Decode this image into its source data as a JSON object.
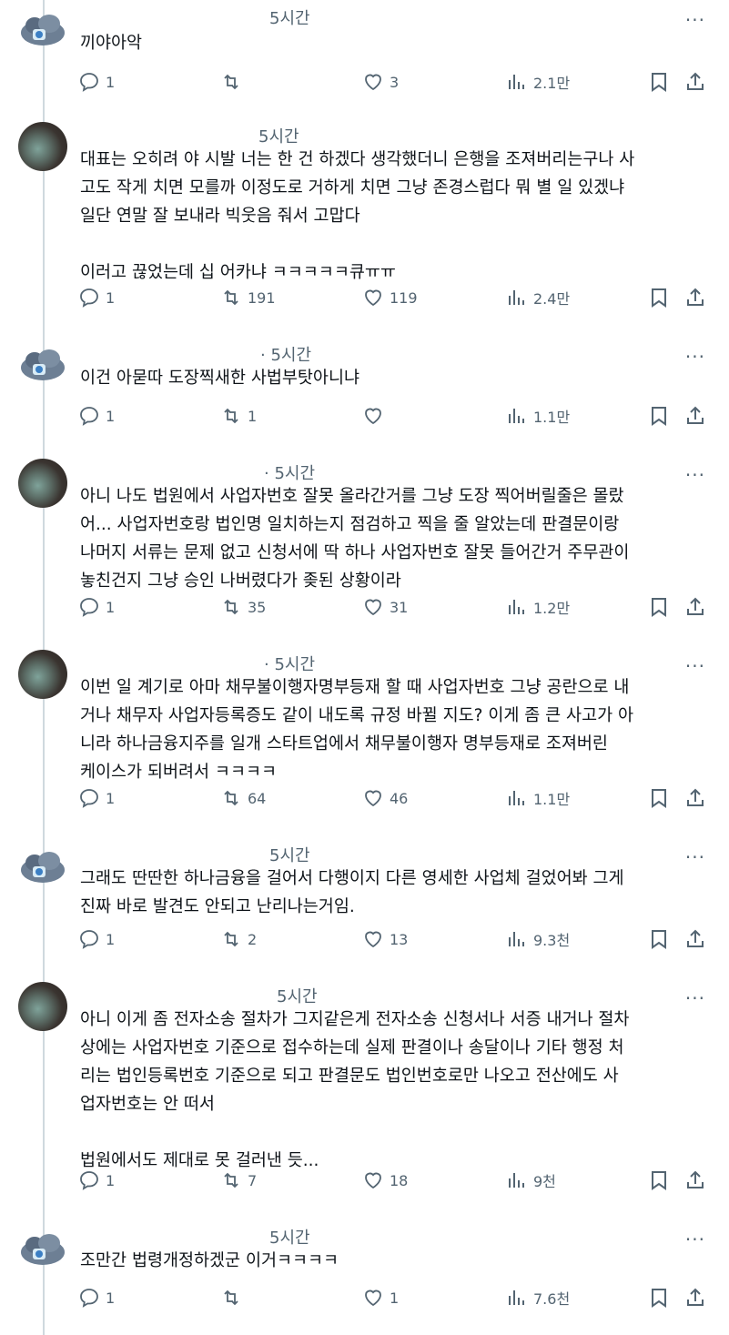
{
  "tweets": [
    {
      "time": "5시간",
      "text": "끼야아악",
      "replies": "1",
      "retweets": "",
      "likes": "3",
      "views": "2.1만",
      "avatar": "cloud-icon"
    },
    {
      "time": "5시간",
      "text": "대표는 오히려 야 시발 너는 한 건 하겠다 생각했더니 은행을 조져버리는구나 사\n고도 작게 치면 모를까 이정도로 거하게 치면 그냥 존경스럽다 뭐 별 일 있겠냐\n일단 연말 잘 보내라 빅웃음 줘서 고맙다\n\n이러고 끊었는데 십 어카냐 ㅋㅋㅋㅋㅋ큐ㅠㅠ",
      "replies": "1",
      "retweets": "191",
      "likes": "119",
      "views": "2.4만",
      "avatar": "photo"
    },
    {
      "time": "· 5시간",
      "text": "이건 아묻따 도장찍새한 사법부탓아니냐",
      "replies": "1",
      "retweets": "1",
      "likes": "",
      "views": "1.1만",
      "avatar": "cloud-icon"
    },
    {
      "time": "· 5시간",
      "text": "아니 나도 법원에서 사업자번호 잘못 올라간거를 그냥 도장 찍어버릴줄은 몰랐\n어... 사업자번호랑 법인명 일치하는지 점검하고 찍을 줄 알았는데 판결문이랑\n나머지 서류는 문제 없고 신청서에 딱 하나 사업자번호 잘못 들어간거 주무관이\n놓친건지 그냥 승인 나버렸다가 좆된 상황이라",
      "replies": "1",
      "retweets": "35",
      "likes": "31",
      "views": "1.2만",
      "avatar": "photo"
    },
    {
      "time": "· 5시간",
      "text": "이번 일 계기로 아마 채무불이행자명부등재 할 때 사업자번호 그냥 공란으로 내\n거나 채무자 사업자등록증도 같이 내도록 규정 바뀔 지도? 이게 좀 큰 사고가 아\n니라 하나금융지주를 일개 스타트업에서 채무불이행자 명부등재로 조져버린\n케이스가 되버려서 ㅋㅋㅋㅋ",
      "replies": "1",
      "retweets": "64",
      "likes": "46",
      "views": "1.1만",
      "avatar": "photo"
    },
    {
      "time": "5시간",
      "text": "그래도 딴딴한 하나금융을 걸어서 다행이지 다른 영세한 사업체 걸었어봐 그게\n진짜 바로 발견도 안되고 난리나는거임.",
      "replies": "1",
      "retweets": "2",
      "likes": "13",
      "views": "9.3천",
      "avatar": "cloud-icon"
    },
    {
      "time": "5시간",
      "text": "아니 이게 좀 전자소송 절차가 그지같은게 전자소송 신청서나 서증 내거나 절차\n상에는 사업자번호 기준으로 접수하는데 실제 판결이나 송달이나 기타 행정 처\n리는 법인등록번호 기준으로 되고 판결문도 법인번호로만 나오고 전산에도 사\n업자번호는 안 떠서\n\n법원에서도 제대로 못 걸러낸 듯...",
      "replies": "1",
      "retweets": "7",
      "likes": "18",
      "views": "9천",
      "avatar": "photo"
    },
    {
      "time": "5시간",
      "text": "조만간 법령개정하겠군 이거ㅋㅋㅋㅋ",
      "replies": "1",
      "retweets": "",
      "likes": "1",
      "views": "7.6천",
      "avatar": "cloud-icon"
    }
  ],
  "colors": {
    "text": "#0f1419",
    "muted": "#536471",
    "line": "#cfd9de"
  }
}
